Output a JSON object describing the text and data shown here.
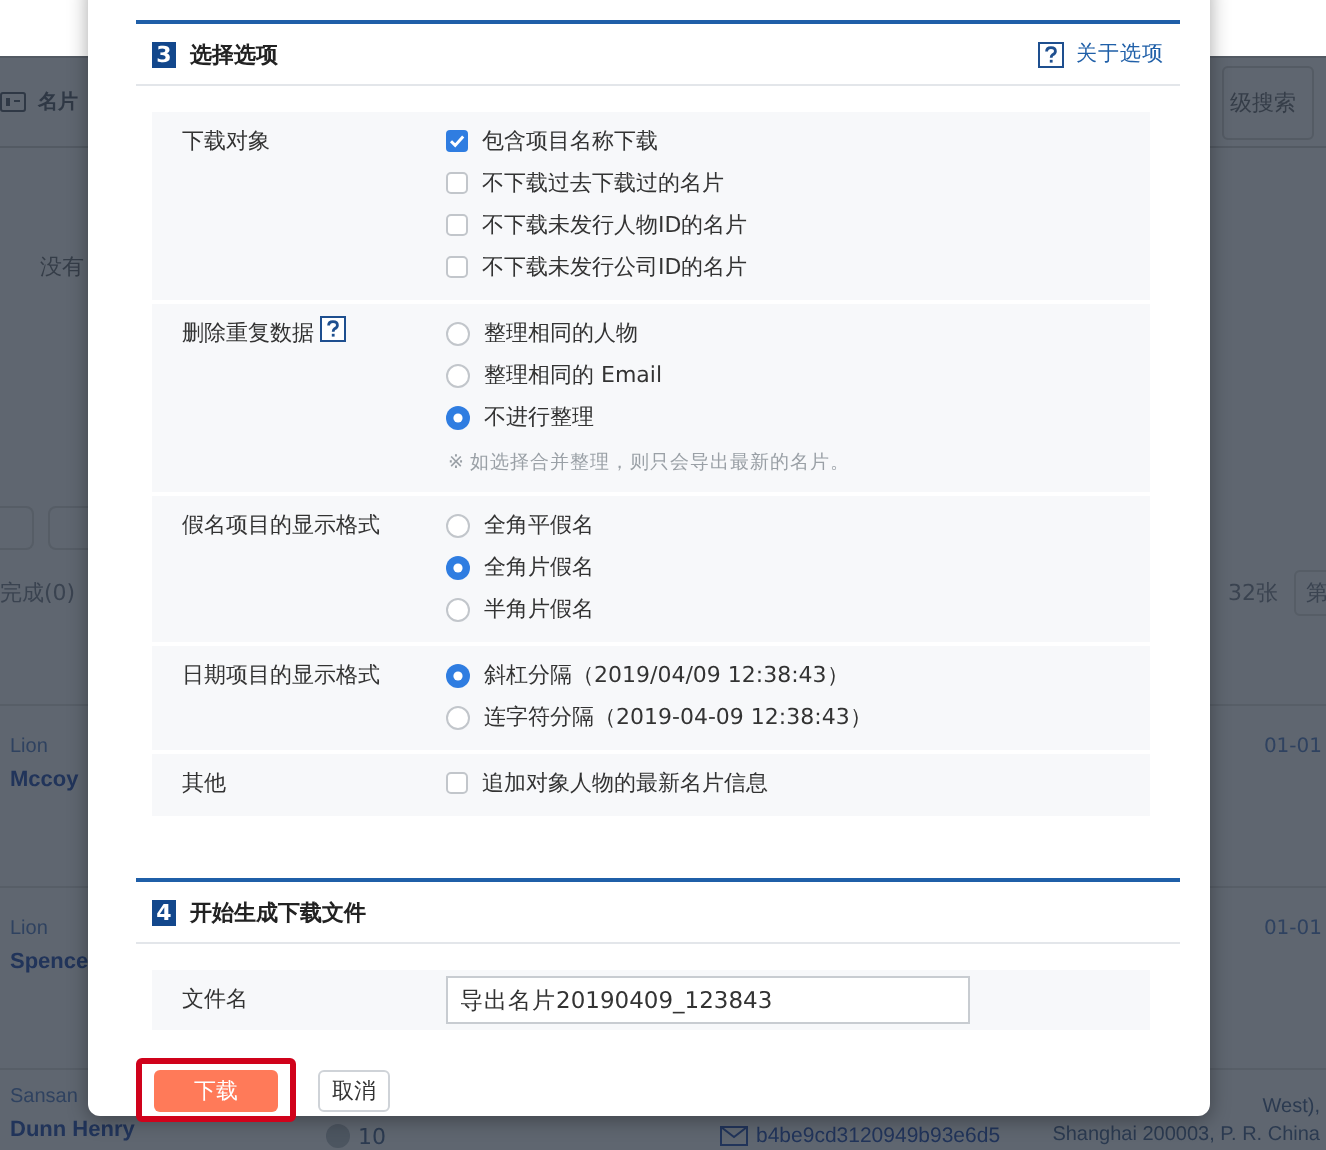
{
  "background": {
    "nav_title": "名片",
    "advanced_search": "级搜索",
    "empty_message": "没有",
    "status_tab": "完成(0)",
    "count": "32张",
    "page_button": "第",
    "cards": [
      {
        "company": "Lion",
        "name": "Mccoy",
        "date": "01-01"
      },
      {
        "company": "Lion",
        "name": "Spence",
        "date": "01-01"
      },
      {
        "company": "Sansan",
        "name": "Dunn Henry",
        "count": "10",
        "email": "b4be9cd3120949b93e6d5",
        "address_1": "West),",
        "address_2": "Shanghai 200003, P. R. China"
      }
    ]
  },
  "sections": [
    {
      "number": "3",
      "title": "选择选项",
      "help_link": "关于选项",
      "rows": [
        {
          "label": "下载对象",
          "kind": "checkbox",
          "options": [
            {
              "label": "包含项目名称下载",
              "checked": true
            },
            {
              "label": "不下载过去下载过的名片",
              "checked": false
            },
            {
              "label": "不下载未发行人物ID的名片",
              "checked": false
            },
            {
              "label": "不下载未发行公司ID的名片",
              "checked": false
            }
          ]
        },
        {
          "label": "删除重复数据",
          "help": true,
          "kind": "radio",
          "options": [
            {
              "label": "整理相同的人物",
              "selected": false
            },
            {
              "label": "整理相同的 Email",
              "selected": false
            },
            {
              "label": "不进行整理",
              "selected": true
            }
          ],
          "note": "※ 如选择合并整理，则只会导出最新的名片。"
        },
        {
          "label": "假名项目的显示格式",
          "kind": "radio",
          "options": [
            {
              "label": "全角平假名",
              "selected": false
            },
            {
              "label": "全角片假名",
              "selected": true
            },
            {
              "label": "半角片假名",
              "selected": false
            }
          ]
        },
        {
          "label": "日期项目的显示格式",
          "kind": "radio",
          "options": [
            {
              "label": "斜杠分隔（2019/04/09 12:38:43）",
              "selected": true
            },
            {
              "label": "连字符分隔（2019-04-09 12:38:43）",
              "selected": false
            }
          ]
        },
        {
          "label": "其他",
          "kind": "checkbox",
          "options": [
            {
              "label": "追加对象人物的最新名片信息",
              "checked": false
            }
          ]
        }
      ]
    },
    {
      "number": "4",
      "title": "开始生成下载文件",
      "rows": [
        {
          "label": "文件名",
          "kind": "text",
          "value": "导出名片20190409_123843"
        }
      ]
    }
  ],
  "buttons": [
    {
      "label": "下载",
      "kind": "primary",
      "highlighted": true
    },
    {
      "label": "取消",
      "kind": "secondary"
    }
  ]
}
